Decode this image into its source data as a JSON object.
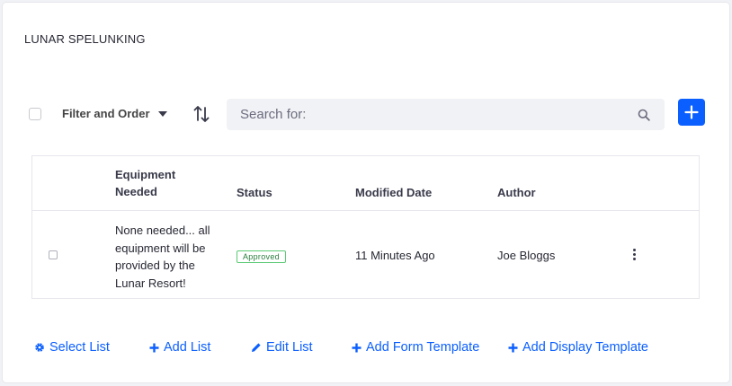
{
  "header": {
    "title": "LUNAR SPELUNKING"
  },
  "toolbar": {
    "filter_label": "Filter and Order",
    "search_placeholder": "Search for:",
    "search_value": ""
  },
  "table": {
    "columns": [
      "Equipment Needed",
      "Status",
      "Modified Date",
      "Author"
    ],
    "rows": [
      {
        "equipment": "None needed... all equipment will be provided by the Lunar Resort!",
        "status": "Approved",
        "modified": "11 Minutes Ago",
        "author": "Joe Bloggs"
      }
    ]
  },
  "footer_links": {
    "select_list": "Select List",
    "add_list": "Add List",
    "edit_list": "Edit List",
    "add_form_template": "Add Form Template",
    "add_display_template": "Add Display Template"
  },
  "colors": {
    "primary": "#0b5fff",
    "approved": "#287d3c",
    "approved_border": "#5aca75"
  },
  "icons": {
    "sort": "sort-arrows-icon",
    "search": "search-icon",
    "add": "plus-icon",
    "select": "gear-icon",
    "edit": "pencil-icon",
    "kebab": "vertical-ellipsis-icon"
  }
}
